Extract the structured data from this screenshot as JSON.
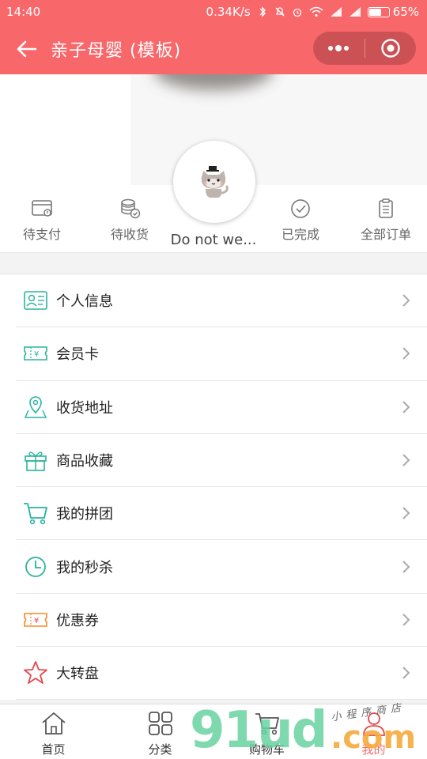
{
  "status_bar": {
    "time": "14:40",
    "net_speed": "0.34K/s",
    "battery": "65%",
    "battery_level": 0.65
  },
  "header": {
    "title": "亲子母婴 (模板)",
    "capsule": {
      "more_icon": "more-dots-icon",
      "close_icon": "target-close-icon"
    }
  },
  "profile": {
    "nickname": "Do not we...",
    "orders": [
      {
        "label": "待支付",
        "icon": "wallet-icon"
      },
      {
        "label": "待收货",
        "icon": "coins-check-icon"
      },
      {
        "label": "已完成",
        "icon": "check-circle-icon"
      },
      {
        "label": "全部订单",
        "icon": "clipboard-icon"
      }
    ]
  },
  "menu": [
    {
      "label": "个人信息",
      "icon": "id-card-icon"
    },
    {
      "label": "会员卡",
      "icon": "member-card-icon"
    },
    {
      "label": "收货地址",
      "icon": "location-pin-icon"
    },
    {
      "label": "商品收藏",
      "icon": "gift-icon"
    },
    {
      "label": "我的拼团",
      "icon": "cart-icon"
    },
    {
      "label": "我的秒杀",
      "icon": "clock-icon"
    },
    {
      "label": "优惠券",
      "icon": "coupon-icon"
    },
    {
      "label": "大转盘",
      "icon": "star-icon"
    }
  ],
  "tabbar": [
    {
      "label": "首页",
      "icon": "home-icon"
    },
    {
      "label": "分类",
      "icon": "grid-icon"
    },
    {
      "label": "购物车",
      "icon": "cart-icon"
    },
    {
      "label": "我的",
      "icon": "user-icon",
      "active": true
    }
  ],
  "watermark": {
    "brand": "91ud",
    "suffix": ".com",
    "tagline": "小程序商店"
  },
  "colors": {
    "accent": "#f8676a",
    "teal": "#2ab3a0",
    "red_icon": "#e5484d",
    "orange_icon": "#f08a24"
  }
}
